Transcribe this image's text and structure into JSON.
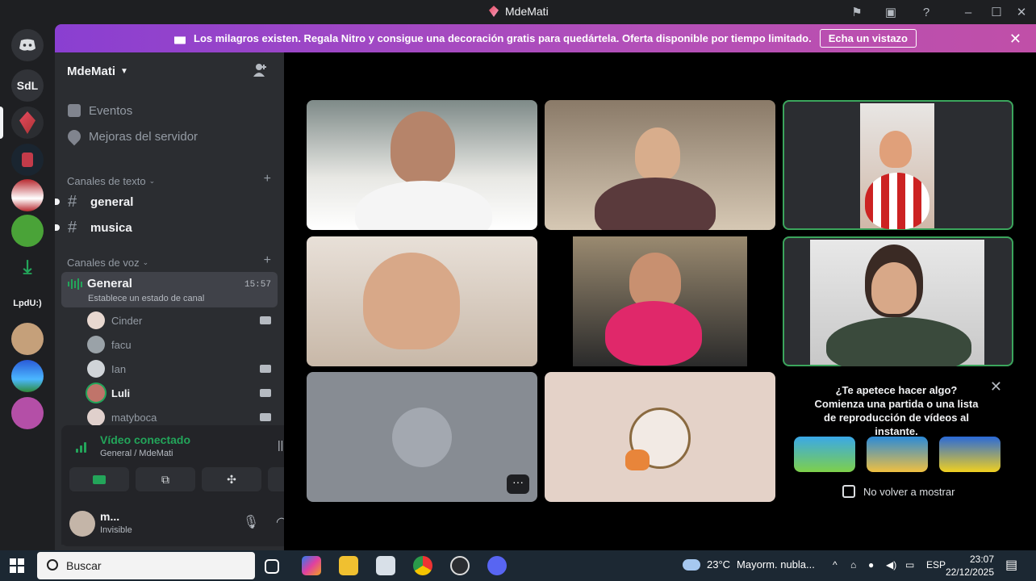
{
  "window": {
    "title": "MdeMati"
  },
  "servers": [
    {
      "label": "SdL"
    },
    {
      "label": "LpdU:)"
    }
  ],
  "banner": {
    "text": "Los milagros existen. Regala Nitro y consigue una decoración gratis para quedártela. Oferta disponible por tiempo limitado.",
    "button": "Echa un vistazo"
  },
  "server": {
    "name": "MdeMati",
    "menu": [
      "Eventos",
      "Mejoras del servidor"
    ],
    "text_category": "Canales de texto",
    "text_channels": [
      "general",
      "musica"
    ],
    "voice_category": "Canales de voz",
    "voice_channel": {
      "name": "General",
      "time": "15:57",
      "status": "Establece un estado de canal"
    },
    "members": [
      "Cinder",
      "facu",
      "Ian",
      "Luli",
      "matyboca"
    ]
  },
  "voice_panel": {
    "status": "Vídeo conectado",
    "location": "General / MdeMati"
  },
  "user": {
    "name": "m...",
    "status": "Invisible"
  },
  "activity": {
    "question": "¿Te apetece hacer algo?",
    "body": "Comienza una partida o una lista de reproducción de vídeos al instante.",
    "checkbox": "No volver a mostrar"
  },
  "taskbar": {
    "search": "Buscar",
    "weather_temp": "23°C",
    "weather_desc": "Mayorm. nubla...",
    "lang": "ESP",
    "time": "23:07",
    "date": "22/12/2025"
  },
  "colors": {
    "accent_green": "#23a55a",
    "banner_purple": "#8a3fd1",
    "sidebar": "#2b2d31"
  }
}
